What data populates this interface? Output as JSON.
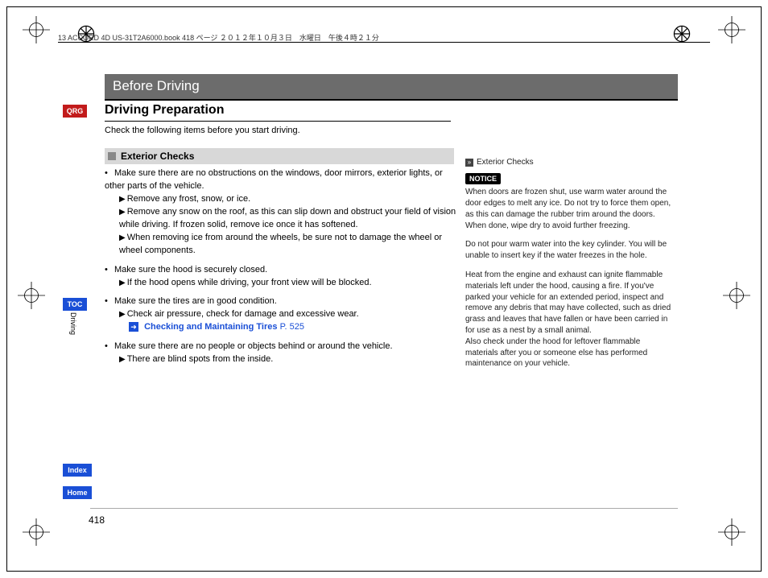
{
  "header_line": "13 ACCORD 4D US-31T2A6000.book  418 ページ  ２０１２年１０月３日　水曜日　午後４時２１分",
  "chapter": "Before Driving",
  "section_title": "Driving Preparation",
  "intro": "Check the following items before you start driving.",
  "subsection": "Exterior Checks",
  "bullets": {
    "b1": "Make sure there are no obstructions on the windows, door mirrors, exterior lights, or other parts of the vehicle.",
    "b1a": "Remove any frost, snow, or ice.",
    "b1b": "Remove any snow on the roof, as this can slip down and obstruct your field of vision while driving. If frozen solid, remove ice once it has softened.",
    "b1c": "When removing ice from around the wheels, be sure not to damage the wheel or wheel components.",
    "b2": "Make sure the hood is securely closed.",
    "b2a": "If the hood opens while driving, your front view will be blocked.",
    "b3": "Make sure the tires are in good condition.",
    "b3a": "Check air pressure, check for damage and excessive wear.",
    "b3_xref_label": "Checking and Maintaining Tires",
    "b3_xref_page": "P. 525",
    "b4": "Make sure there are no people or objects behind or around the vehicle.",
    "b4a": "There are blind spots from the inside."
  },
  "side": {
    "head": "Exterior Checks",
    "notice_label": "NOTICE",
    "p1": "When doors are frozen shut, use warm water around the door edges to melt any ice. Do not try to force them open, as this can damage the rubber trim around the doors. When done, wipe dry to avoid further freezing.",
    "p2": "Do not pour warm water into the key cylinder. You will be unable to insert key if the water freezes in the hole.",
    "p3": "Heat from the engine and exhaust can ignite flammable materials left under the hood, causing a fire. If you've parked your vehicle for an extended period, inspect and remove any debris that may have collected, such as dried grass and leaves that have fallen or have been carried in for use as a nest by a small animal.",
    "p4": "Also check under the hood for leftover flammable materials after you or someone else has performed maintenance on your vehicle."
  },
  "tabs": {
    "qrg": "QRG",
    "toc": "TOC",
    "index": "Index",
    "home": "Home",
    "vlabel": "Driving"
  },
  "page_number": "418"
}
